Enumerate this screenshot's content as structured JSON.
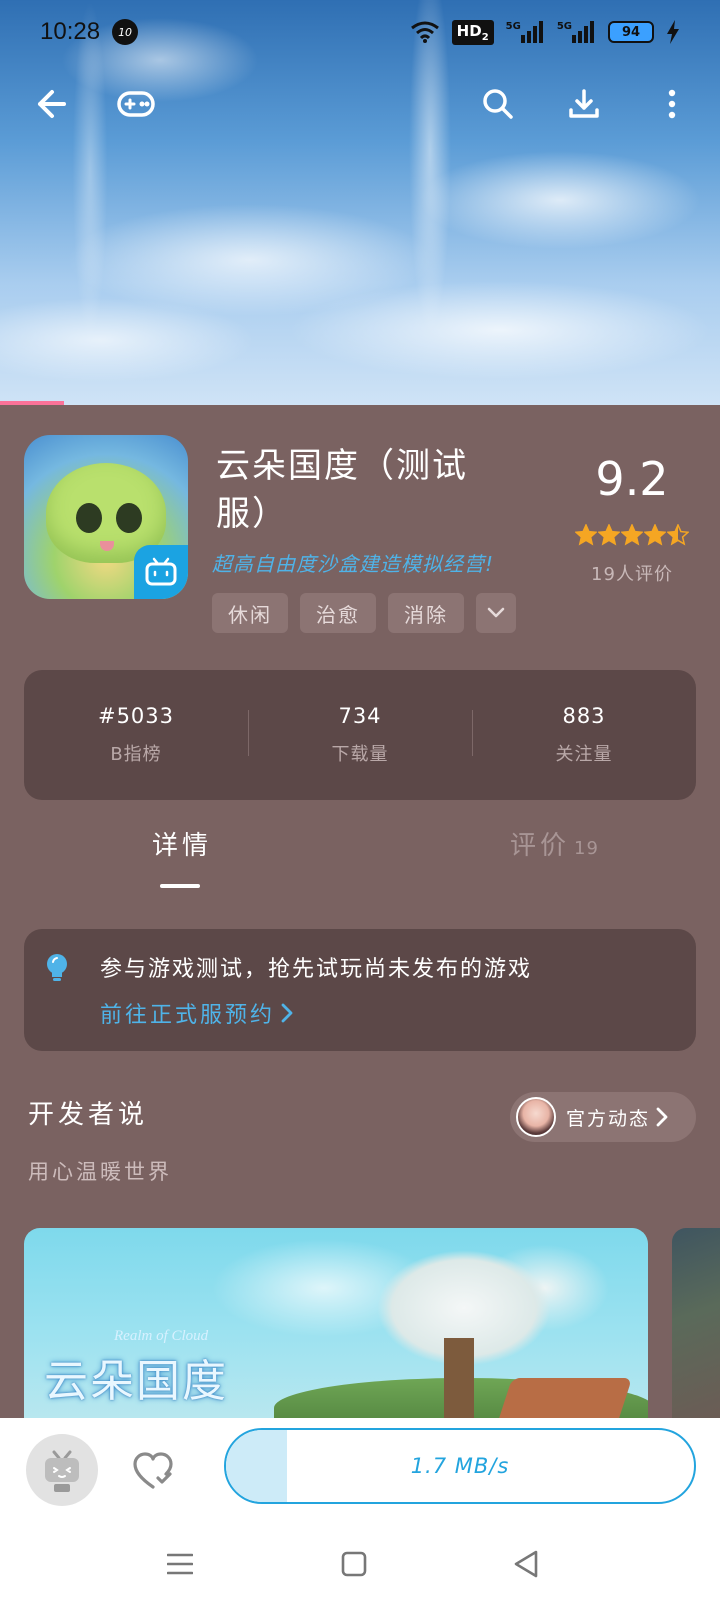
{
  "status_bar": {
    "time": "10:28",
    "notification_badge": "10",
    "network_label": "HD",
    "network_sub": "2",
    "signal_1": "5G",
    "signal_2": "5G",
    "battery": "94"
  },
  "nav": {
    "icons": [
      "back-arrow-icon",
      "gamepad-icon",
      "search-icon",
      "download-icon",
      "more-vertical-icon"
    ]
  },
  "app": {
    "title": "云朵国度（测试服）",
    "subtitle": "超高自由度沙盒建造模拟经营!",
    "tags": [
      "休闲",
      "治愈",
      "消除"
    ],
    "rating": "9.2",
    "stars": 4.5,
    "rating_count": "19人评价"
  },
  "stats": [
    {
      "value": "#5033",
      "label": "B指榜"
    },
    {
      "value": "734",
      "label": "下载量"
    },
    {
      "value": "883",
      "label": "关注量"
    }
  ],
  "tabs": {
    "details": "详情",
    "reviews": "评价",
    "reviews_count": "19"
  },
  "notice": {
    "text": "参与游戏测试，抢先试玩尚未发布的游戏",
    "link": "前往正式服预约"
  },
  "developer": {
    "title": "开发者说",
    "official_label": "官方动态",
    "quote": "用心温暖世界"
  },
  "screenshots": {
    "logo_en": "Realm of Cloud",
    "logo_cn": "云朵国度"
  },
  "action_bar": {
    "download_speed": "1.7 MB/s",
    "download_progress": 0.13
  },
  "colors": {
    "background": "#7a6261",
    "card": "#5c4848",
    "accent_blue": "#23a4de",
    "link_blue": "#4fb3e8",
    "star": "#f5a623",
    "hero_progress": "#fb7299"
  }
}
